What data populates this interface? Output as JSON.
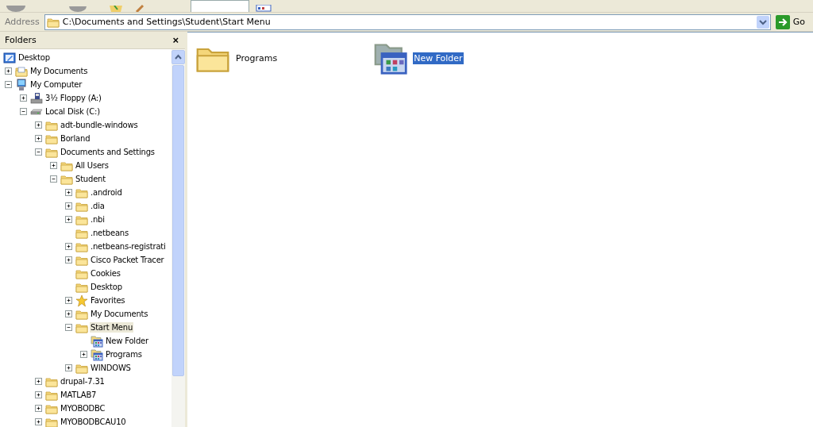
{
  "address_bar": {
    "label": "Address",
    "value": "C:\\Documents and Settings\\Student\\Start Menu",
    "go": "Go"
  },
  "folders_pane": {
    "title": "Folders",
    "close": "×",
    "tree": [
      {
        "label": "Desktop",
        "kind": "desktop",
        "selected": false,
        "children": [
          {
            "label": "My Documents",
            "kind": "documents",
            "expanded": false,
            "selected": false
          },
          {
            "label": "My Computer",
            "kind": "computer",
            "expanded": true,
            "selected": false,
            "children": [
              {
                "label": "3½ Floppy (A:)",
                "kind": "floppy",
                "expanded": false,
                "selected": false
              },
              {
                "label": "Local Disk (C:)",
                "kind": "disk",
                "expanded": true,
                "selected": false,
                "children": [
                  {
                    "label": "adt-bundle-windows",
                    "kind": "folder",
                    "expanded": false,
                    "selected": false
                  },
                  {
                    "label": "Borland",
                    "kind": "folder",
                    "expanded": false,
                    "selected": false
                  },
                  {
                    "label": "Documents and Settings",
                    "kind": "folder",
                    "expanded": true,
                    "selected": false,
                    "children": [
                      {
                        "label": "All Users",
                        "kind": "folder",
                        "expanded": false,
                        "selected": false
                      },
                      {
                        "label": "Student",
                        "kind": "folder",
                        "expanded": true,
                        "selected": false,
                        "children": [
                          {
                            "label": ".android",
                            "kind": "folder",
                            "expanded": false,
                            "selected": false
                          },
                          {
                            "label": ".dia",
                            "kind": "folder",
                            "expanded": false,
                            "selected": false
                          },
                          {
                            "label": ".nbi",
                            "kind": "folder",
                            "expanded": false,
                            "selected": false
                          },
                          {
                            "label": ".netbeans",
                            "kind": "folder",
                            "selected": false
                          },
                          {
                            "label": ".netbeans-registrati",
                            "kind": "folder",
                            "expanded": false,
                            "selected": false
                          },
                          {
                            "label": "Cisco Packet Tracer",
                            "kind": "folder",
                            "expanded": false,
                            "selected": false
                          },
                          {
                            "label": "Cookies",
                            "kind": "folder",
                            "selected": false
                          },
                          {
                            "label": "Desktop",
                            "kind": "folder",
                            "selected": false
                          },
                          {
                            "label": "Favorites",
                            "kind": "star",
                            "expanded": false,
                            "selected": false
                          },
                          {
                            "label": "My Documents",
                            "kind": "folder",
                            "expanded": false,
                            "selected": false
                          },
                          {
                            "label": "Start Menu",
                            "kind": "folder",
                            "expanded": true,
                            "selected": true,
                            "children": [
                              {
                                "label": "New Folder",
                                "kind": "programs",
                                "selected": false
                              },
                              {
                                "label": "Programs",
                                "kind": "programs",
                                "expanded": false,
                                "selected": false
                              }
                            ]
                          },
                          {
                            "label": "WINDOWS",
                            "kind": "folder",
                            "expanded": false,
                            "selected": false
                          }
                        ]
                      }
                    ]
                  },
                  {
                    "label": "drupal-7.31",
                    "kind": "folder",
                    "expanded": false,
                    "selected": false
                  },
                  {
                    "label": "MATLAB7",
                    "kind": "folder",
                    "expanded": false,
                    "selected": false
                  },
                  {
                    "label": "MYOBODBC",
                    "kind": "folder",
                    "expanded": false,
                    "selected": false
                  },
                  {
                    "label": "MYOBODBCAU10",
                    "kind": "folder",
                    "expanded": false,
                    "selected": false
                  }
                ]
              }
            ]
          }
        ]
      }
    ]
  },
  "items": [
    {
      "label": "Programs",
      "kind": "folder",
      "selected": false
    },
    {
      "label": "New Folder",
      "kind": "programs",
      "selected": true
    }
  ]
}
